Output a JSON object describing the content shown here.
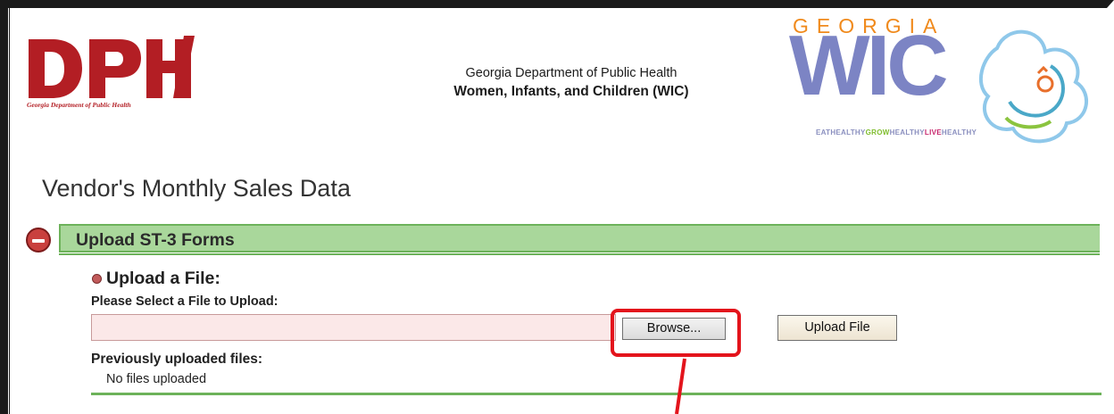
{
  "logo_left": {
    "text": "DPH",
    "caption": "Georgia Department of Public Health",
    "color": "#b31e24"
  },
  "header": {
    "line1": "Georgia Department of Public Health",
    "line2": "Women, Infants, and Children (WIC)"
  },
  "logo_right": {
    "top": "GEORGIA",
    "main": "WIC",
    "tagline": [
      "EAT",
      "HEALTHY",
      "GROW",
      "HEALTHY",
      "LIVE",
      "HEALTHY"
    ]
  },
  "page": {
    "title": "Vendor's Monthly Sales Data"
  },
  "panel": {
    "title": "Upload ST-3 Forms",
    "collapse_icon": "minus-circle-icon"
  },
  "upload": {
    "heading": "Upload a File:",
    "select_label": "Please Select a File to Upload:",
    "file_value": "",
    "browse_label": "Browse...",
    "upload_label": "Upload File",
    "previous_label": "Previously uploaded files:",
    "no_files": "No files uploaded"
  },
  "colors": {
    "panel_green": "#a9d79b",
    "highlight_red": "#e3141c",
    "input_pink": "#fbe8e8"
  }
}
